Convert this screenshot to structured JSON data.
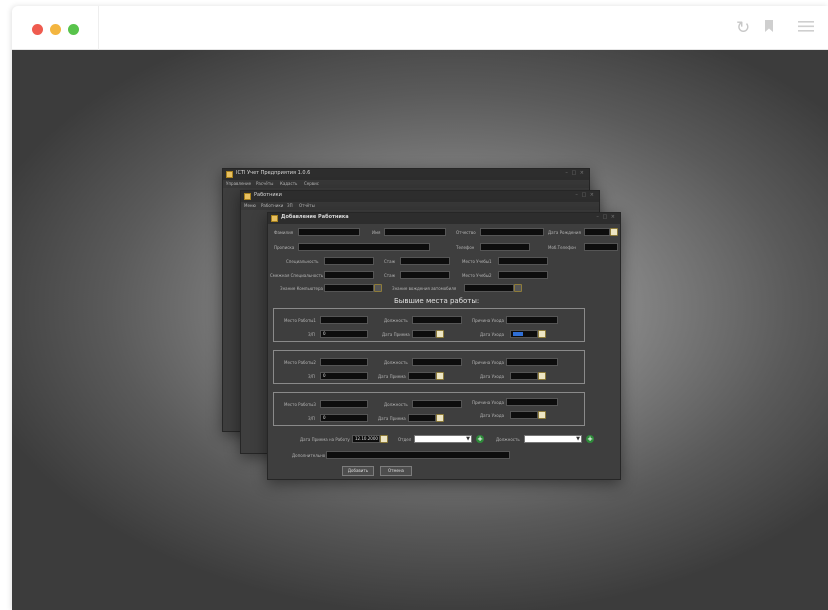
{
  "app": {
    "title": "ICTI Учет Предприятия 1.0.6",
    "menu": [
      "Управление",
      "Расчёты",
      "Кадасть",
      "Сервис"
    ]
  },
  "employees_window": {
    "title": "Работники",
    "menu": [
      "Меню",
      "Работники",
      "ЗП",
      "Отчёты"
    ]
  },
  "add_dialog": {
    "title": "Добавление Работника",
    "fields": {
      "surname": "Фамилия",
      "name": "Имя",
      "patronymic": "Отчество",
      "birth_date": "Дата Рождения",
      "address": "Прописка",
      "phone": "Телефон",
      "mob_phone": "Моб.Телефон",
      "specialty": "Специальность",
      "experience": "Стаж",
      "study_place1": "Место Учебы1",
      "related_specialty": "Смежная Специальность",
      "experience2": "Стаж",
      "study_place2": "Место Учебы2",
      "pc_knowledge": "Знание Компьютера",
      "driving": "Знание вождения автомобиля"
    },
    "former_jobs_title": "Бывшие места работы:",
    "jobs": [
      {
        "place": "Место Работы1",
        "position": "Должность",
        "leave_reason": "Причина Ухода",
        "salary": "З/П",
        "salary_value": "0",
        "hire_date": "Дата Приема",
        "leave_date": "Дата Ухода"
      },
      {
        "place": "Место Работы2",
        "position": "Должность",
        "leave_reason": "Причина Ухода",
        "salary": "З/П",
        "salary_value": "0",
        "hire_date": "Дата Приема",
        "leave_date": "Дата Ухода"
      },
      {
        "place": "Место Работы3",
        "position": "Должность",
        "leave_reason": "Причина Ухода",
        "salary": "З/П",
        "salary_value": "0",
        "hire_date": "Дата Приема",
        "leave_date": "Дата Ухода"
      }
    ],
    "hire_date_label": "Дата Приема на Работу",
    "hire_date_value": "12.10.2000",
    "department_label": "Отдел",
    "position_label": "Должность",
    "additional_label": "Дополнительно",
    "add_button": "Добавить",
    "cancel_button": "Отмена"
  },
  "icons": [
    "reload-icon",
    "bookmark-icon",
    "menu-icon",
    "calendar-icon",
    "plus-icon"
  ],
  "colors": {
    "close_dot": "#ef5b4f",
    "minimize_dot": "#f3b540",
    "maximize_dot": "#58c34b",
    "selected_date": "#2f6fd6",
    "add_green": "#2e8b3a"
  }
}
